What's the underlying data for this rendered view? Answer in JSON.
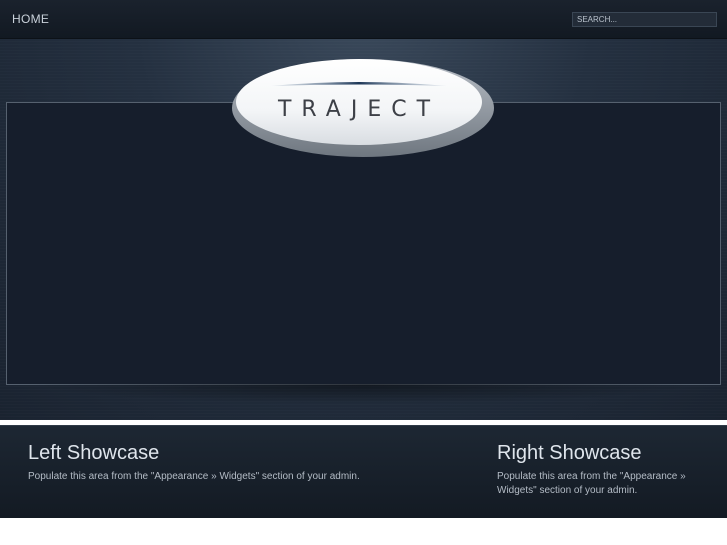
{
  "nav": {
    "home_label": "HOME"
  },
  "search": {
    "placeholder": "SEARCH..."
  },
  "logo": {
    "text": "TRAJECT"
  },
  "showcase": {
    "left_title": "Left Showcase",
    "left_text": "Populate this area from the \"Appearance » Widgets\" section of your admin.",
    "right_title": "Right Showcase",
    "right_text": "Populate this area from the \"Appearance » Widgets\" section of your admin."
  },
  "colors": {
    "background": "#243040",
    "topbar": "#161e28",
    "frame": "#161e2c",
    "text": "#dfe5ec"
  }
}
